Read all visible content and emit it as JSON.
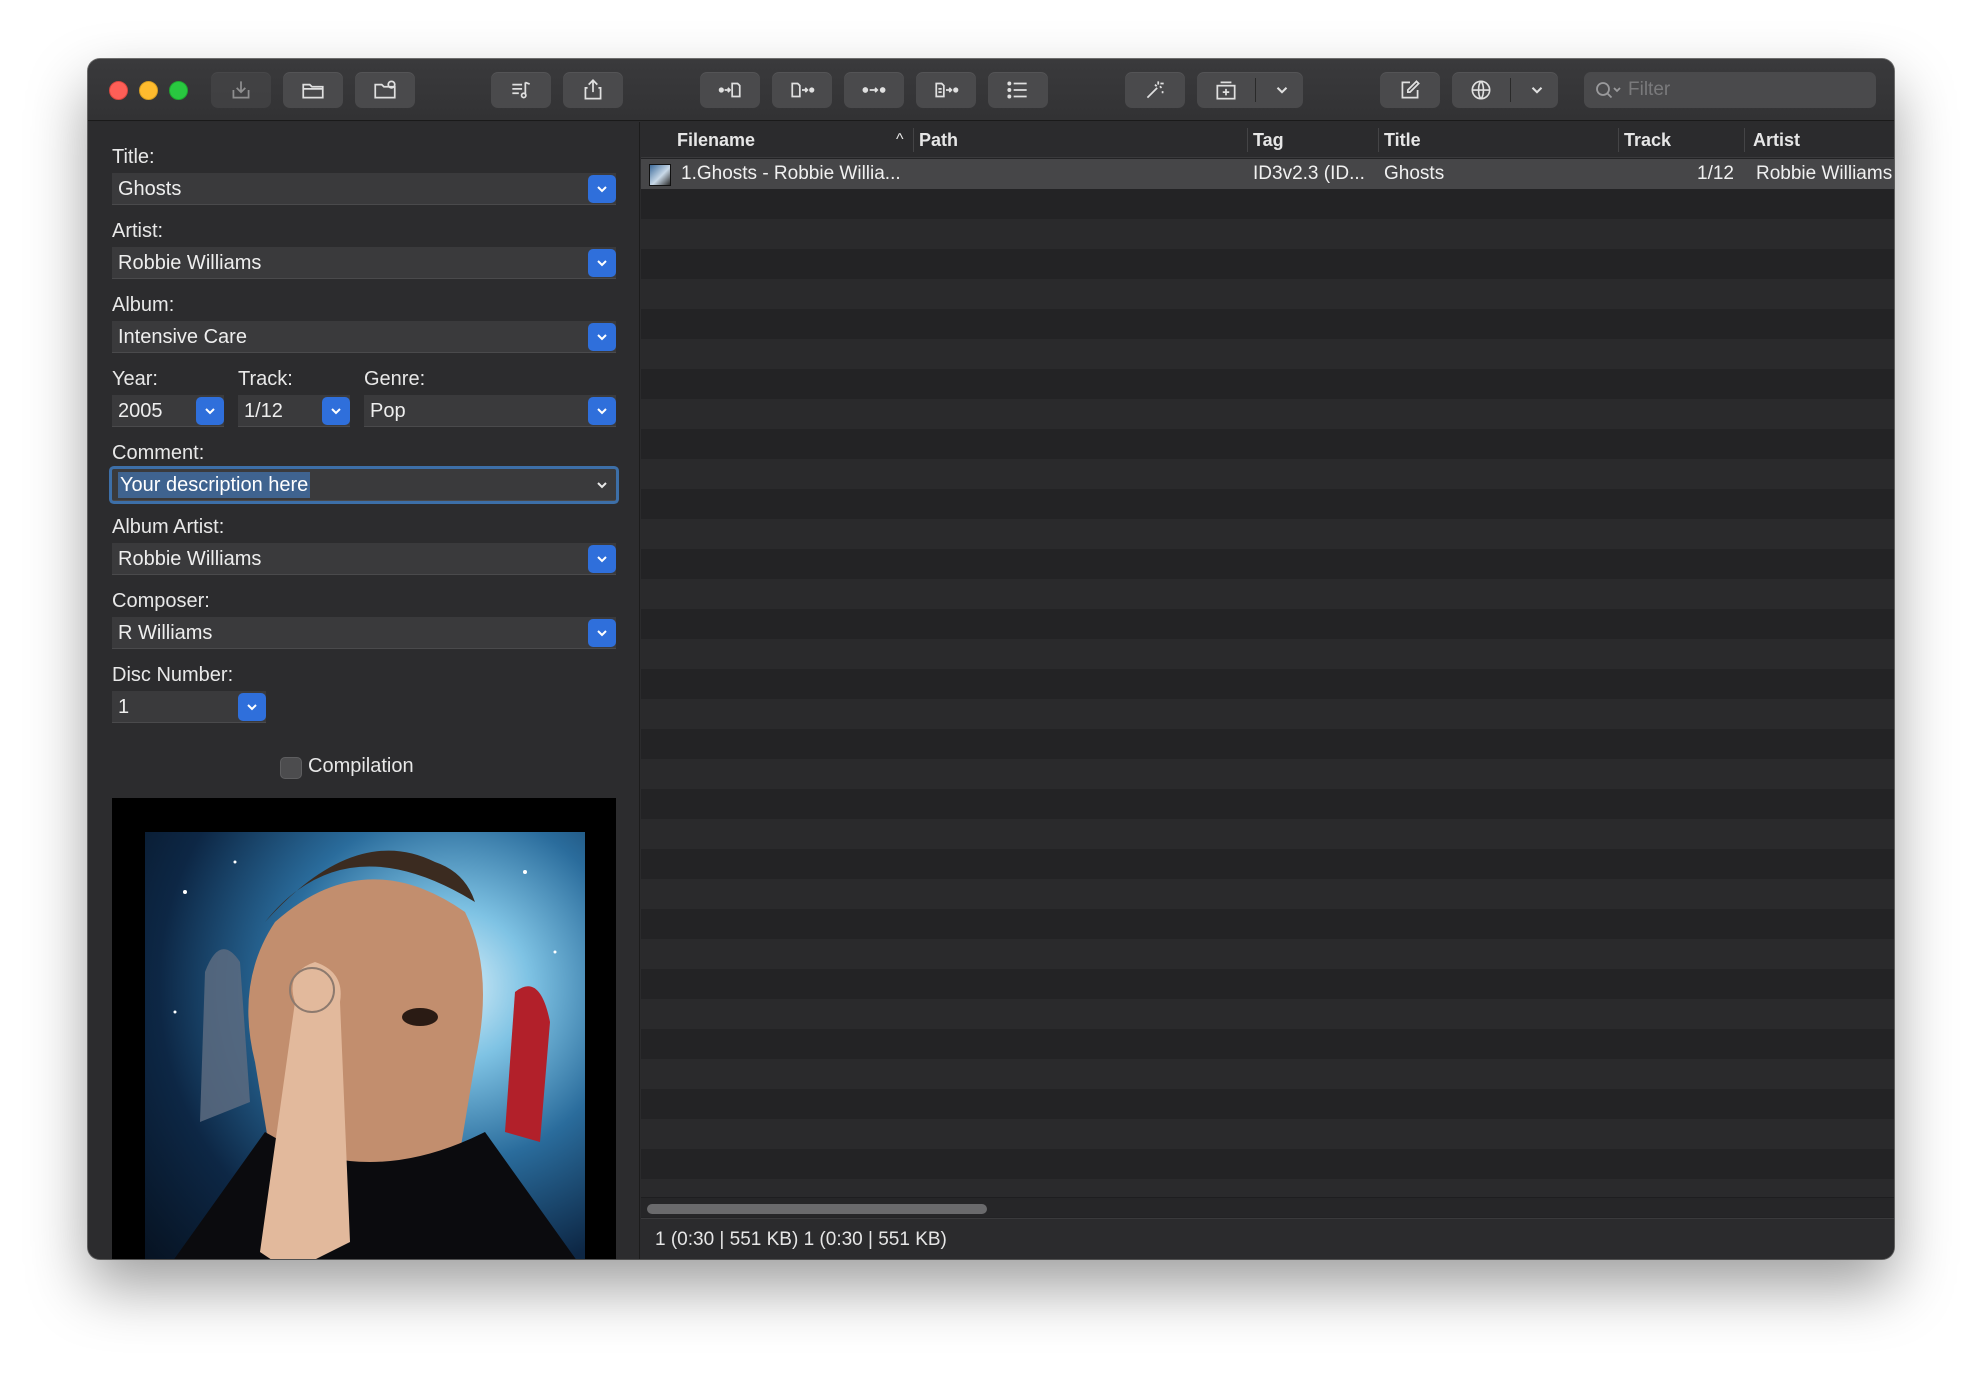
{
  "window": {
    "traffic": {
      "close": "close-button",
      "minimize": "minimize-button",
      "zoom": "zoom-button"
    }
  },
  "toolbar": {
    "filter_placeholder": "Filter",
    "icons": [
      "save-icon",
      "open-folder-icon",
      "add-folder-icon",
      "playlist-icon",
      "export-icon",
      "tag-from-filename-icon",
      "filename-from-tag-icon",
      "tag-to-tag-icon",
      "text-file-to-tag-icon",
      "list-icon",
      "magic-wand-icon",
      "actions-icon",
      "edit-icon",
      "web-sources-icon",
      "search-icon"
    ]
  },
  "editor": {
    "title": {
      "label": "Title:",
      "value": "Ghosts"
    },
    "artist": {
      "label": "Artist:",
      "value": "Robbie Williams"
    },
    "album": {
      "label": "Album:",
      "value": "Intensive Care"
    },
    "year": {
      "label": "Year:",
      "value": "2005"
    },
    "track": {
      "label": "Track:",
      "value": "1/12"
    },
    "genre": {
      "label": "Genre:",
      "value": "Pop"
    },
    "comment": {
      "label": "Comment:",
      "value": "Your description here"
    },
    "album_artist": {
      "label": "Album Artist:",
      "value": "Robbie Williams"
    },
    "composer": {
      "label": "Composer:",
      "value": "R Williams"
    },
    "disc_number": {
      "label": "Disc Number:",
      "value": "1"
    },
    "compilation": {
      "label": "Compilation",
      "checked": false
    }
  },
  "filelist": {
    "columns": [
      "Filename",
      "Path",
      "Tag",
      "Title",
      "Track",
      "Artist"
    ],
    "sort_indicator": "^",
    "rows": [
      {
        "filename": "1.Ghosts - Robbie Willia...",
        "path": "",
        "tag": "ID3v2.3 (ID...",
        "title": "Ghosts",
        "track": "1/12",
        "artist": "Robbie Williams"
      }
    ]
  },
  "status": {
    "text": "1 (0:30 | 551 KB)  1 (0:30 | 551 KB)"
  },
  "colors": {
    "accent": "#2f6fdb",
    "selection": "#3f638f",
    "window_bg": "#2b2b2d"
  }
}
